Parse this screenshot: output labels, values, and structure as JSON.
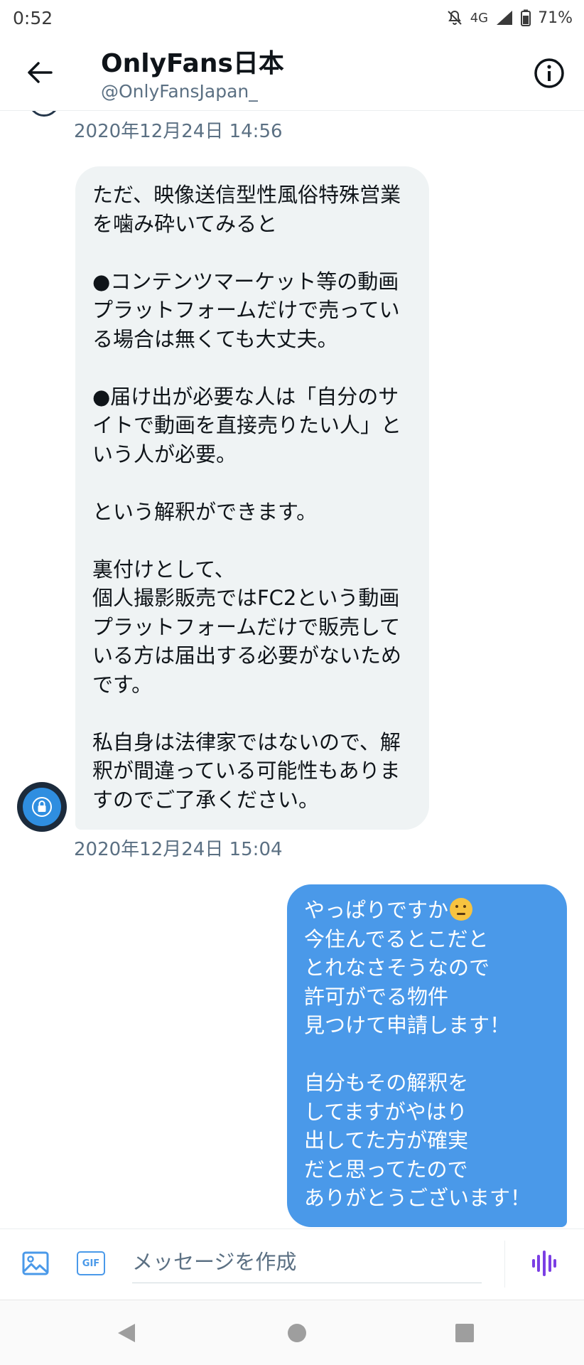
{
  "status_bar": {
    "time": "0:52",
    "network": "4G",
    "battery": "71%"
  },
  "header": {
    "title": "OnlyFans日本",
    "handle": "@OnlyFansJapan_"
  },
  "messages": [
    {
      "timestamp": "2020年12月24日 14:56"
    },
    {
      "direction": "incoming",
      "paragraphs": [
        "ただ、映像送信型性風俗特殊営業を噛み砕いてみると",
        "●コンテンツマーケット等の動画プラットフォームだけで売っている場合は無くても大丈夫。",
        "●届け出が必要な人は「自分のサイトで動画を直接売りたい人」という人が必要。",
        "という解釈ができます。",
        "裏付けとして、",
        "個人撮影販売ではFC2という動画プラットフォームだけで販売している方は届出する必要がないためです。",
        "私自身は法律家ではないので、解釈が間違っている可能性もありますのでご了承ください。"
      ],
      "timestamp": "2020年12月24日 15:04"
    },
    {
      "direction": "outgoing",
      "lines_1": [
        "やっぱりですか",
        "今住んでるとこだと",
        "とれなさそうなので",
        "許可がでる物件",
        "見つけて申請します！"
      ],
      "emoji": "thinking-face",
      "lines_2": [
        "自分もその解釈を",
        "してますがやはり",
        "出してた方が確実",
        "だと思ってたので",
        "ありがとうございます！"
      ]
    }
  ],
  "composer": {
    "gif_label": "GIF",
    "placeholder": "メッセージを作成"
  },
  "colors": {
    "accent": "#4a99e9",
    "incoming_bubble": "#eff3f4",
    "secondary_text": "#5b7083",
    "voice_icon": "#7b3fe4"
  }
}
